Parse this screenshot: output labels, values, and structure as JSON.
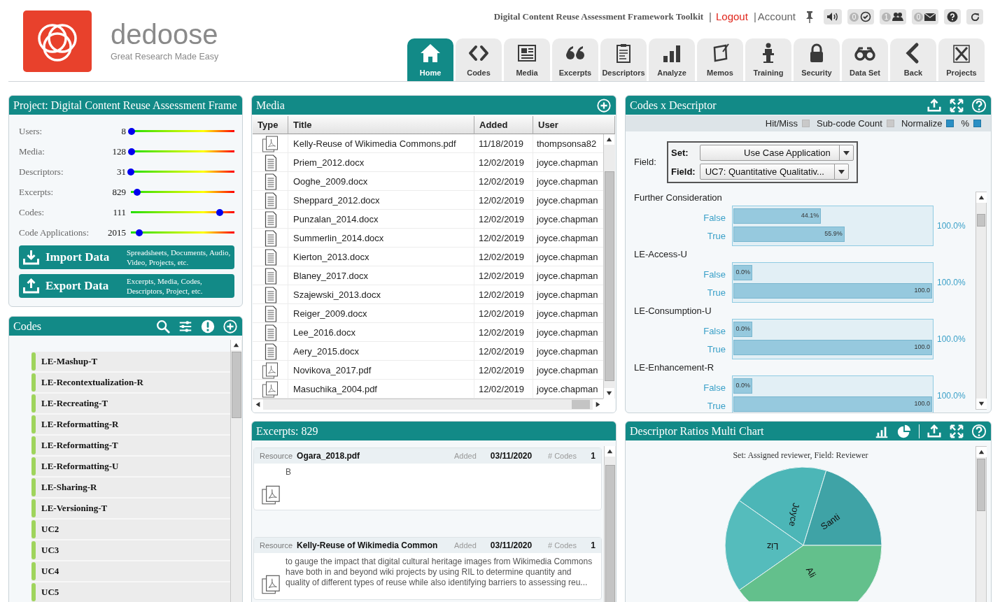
{
  "header": {
    "logo": {
      "wordmark": "dedoose",
      "tagline": "Great Research Made Easy"
    },
    "project_name": "Digital Content Reuse Assessment Framework Toolkit",
    "links": [
      {
        "separator": "|",
        "label": "Logout",
        "kind": "logout"
      },
      {
        "separator": "|",
        "label": "Account",
        "kind": "account"
      }
    ],
    "notifications": [
      {
        "kind": "tasks",
        "count": "0"
      },
      {
        "kind": "users",
        "count": "1"
      },
      {
        "kind": "messages",
        "count": "0"
      }
    ],
    "nav": [
      {
        "label": "Home",
        "selected": true
      },
      {
        "label": "Codes",
        "selected": false
      },
      {
        "label": "Media",
        "selected": false
      },
      {
        "label": "Excerpts",
        "selected": false
      },
      {
        "label": "Descriptors",
        "selected": false
      },
      {
        "label": "Analyze",
        "selected": false
      },
      {
        "label": "Memos",
        "selected": false
      },
      {
        "label": "Training",
        "selected": false
      },
      {
        "label": "Security",
        "selected": false
      },
      {
        "label": "Data Set",
        "selected": false
      },
      {
        "label": "Back",
        "selected": false
      },
      {
        "label": "Projects",
        "selected": false
      }
    ]
  },
  "project_panel": {
    "title": "Project: Digital Content Reuse Assessment Frame",
    "stats": [
      {
        "label": "Users:",
        "value": "8",
        "level": 0.01
      },
      {
        "label": "Media:",
        "value": "128",
        "level": 0.01
      },
      {
        "label": "Descriptors:",
        "value": "31",
        "level": 0
      },
      {
        "label": "Excerpts:",
        "value": "829",
        "level": 0.06
      },
      {
        "label": "Codes:",
        "value": "111",
        "level": 0.86
      },
      {
        "label": "Code Applications:",
        "value": "2015",
        "level": 0.08
      }
    ],
    "actions": [
      {
        "kind": "import",
        "label": "Import Data",
        "description": "Spreadsheets, Documents, Audio, Video, Projects, etc."
      },
      {
        "kind": "export",
        "label": "Export Data",
        "description": "Excerpts, Media, Codes, Descriptors, Project, etc."
      }
    ]
  },
  "codes_panel": {
    "title": "Codes",
    "codes": [
      "LE-Mashup-T",
      "LE-Recontextualization-R",
      "LE-Recreating-T",
      "LE-Reformatting-R",
      "LE-Reformatting-T",
      "LE-Reformatting-U",
      "LE-Sharing-R",
      "LE-Versioning-T",
      "UC2",
      "UC3",
      "UC4",
      "UC5"
    ]
  },
  "media_panel": {
    "title": "Media",
    "columns": [
      "Type",
      "Title",
      "Added",
      "User"
    ],
    "rows": [
      {
        "kind": "pdf",
        "title": "Kelly-Reuse of Wikimedia Commons.pdf",
        "added": "11/18/2019",
        "user": "thompsonsa82"
      },
      {
        "kind": "doc",
        "title": "Priem_2012.docx",
        "added": "12/02/2019",
        "user": "joyce.chapman"
      },
      {
        "kind": "doc",
        "title": "Ooghe_2009.docx",
        "added": "12/02/2019",
        "user": "joyce.chapman"
      },
      {
        "kind": "doc",
        "title": "Sheppard_2012.docx",
        "added": "12/02/2019",
        "user": "joyce.chapman"
      },
      {
        "kind": "doc",
        "title": "Punzalan_2014.docx",
        "added": "12/02/2019",
        "user": "joyce.chapman"
      },
      {
        "kind": "doc",
        "title": "Summerlin_2014.docx",
        "added": "12/02/2019",
        "user": "joyce.chapman"
      },
      {
        "kind": "doc",
        "title": "Kierton_2013.docx",
        "added": "12/02/2019",
        "user": "joyce.chapman"
      },
      {
        "kind": "doc",
        "title": "Blaney_2017.docx",
        "added": "12/02/2019",
        "user": "joyce.chapman"
      },
      {
        "kind": "doc",
        "title": "Szajewski_2013.docx",
        "added": "12/02/2019",
        "user": "joyce.chapman"
      },
      {
        "kind": "doc",
        "title": "Reiger_2009.docx",
        "added": "12/02/2019",
        "user": "joyce.chapman"
      },
      {
        "kind": "doc",
        "title": "Lee_2016.docx",
        "added": "12/02/2019",
        "user": "joyce.chapman"
      },
      {
        "kind": "doc",
        "title": "Aery_2015.docx",
        "added": "12/02/2019",
        "user": "joyce.chapman"
      },
      {
        "kind": "pdf",
        "title": "Novikova_2017.pdf",
        "added": "12/02/2019",
        "user": "joyce.chapman"
      },
      {
        "kind": "pdf",
        "title": "Masuchika_2004.pdf",
        "added": "12/02/2019",
        "user": "joyce.chapman"
      }
    ]
  },
  "codes_x_descriptor": {
    "title": "Codes x Descriptor",
    "options": [
      {
        "label": "Hit/Miss",
        "checked": false
      },
      {
        "label": "Sub-code Count",
        "checked": false
      },
      {
        "label": "Normalize",
        "checked": true
      },
      {
        "label": "%",
        "checked": true
      }
    ],
    "field_label": "Field:",
    "set": {
      "label": "Set:",
      "value": "Use Case Application"
    },
    "field": {
      "label": "Field:",
      "value": "UC7: Quantitative Qualitativ..."
    },
    "groups": [
      {
        "name": "Further Consideration",
        "total": "100.0%",
        "bars": [
          {
            "label": "False",
            "value": "44.1%",
            "level": 0.441
          },
          {
            "label": "True",
            "value": "55.9%",
            "level": 0.559
          }
        ]
      },
      {
        "name": "LE-Access-U",
        "total": "100.0%",
        "bars": [
          {
            "label": "False",
            "value": "0.0%",
            "level": 0
          },
          {
            "label": "True",
            "value": "100.0",
            "level": 1
          }
        ]
      },
      {
        "name": "LE-Consumption-U",
        "total": "100.0%",
        "bars": [
          {
            "label": "False",
            "value": "0.0%",
            "level": 0
          },
          {
            "label": "True",
            "value": "100.0",
            "level": 1
          }
        ]
      },
      {
        "name": "LE-Enhancement-R",
        "total": "100.0%",
        "bars": [
          {
            "label": "False",
            "value": "0.0%",
            "level": 0
          },
          {
            "label": "True",
            "value": "100.0",
            "level": 1
          }
        ]
      }
    ]
  },
  "excerpts_panel": {
    "title": "Excerpts: 829",
    "excerpts": [
      {
        "resource_label": "Resource",
        "resource": "Ogara_2018.pdf",
        "added_label": "Added",
        "added": "03/11/2020",
        "codes_label": "# Codes",
        "codes": "1",
        "text": "B"
      },
      {
        "resource_label": "Resource",
        "resource": "Kelly-Reuse of Wikimedia Common",
        "added_label": "Added",
        "added": "03/11/2020",
        "codes_label": "# Codes",
        "codes": "1",
        "text": "to gauge the impact that digital cultural heritage images from Wikimedia Commons have both in and beyond wiki projects by using RIL to determine quantity and quality of different types of reuse while also identifying barriers to assessing reu..."
      }
    ]
  },
  "descriptor_chart": {
    "title": "Descriptor Ratios Multi Chart",
    "subtitle": "Set: Assigned reviewer, Field: Reviewer",
    "slices": [
      {
        "label": "Joyce"
      },
      {
        "label": "Santi"
      },
      {
        "label": "Liz"
      },
      {
        "label": "Ali"
      }
    ]
  }
}
